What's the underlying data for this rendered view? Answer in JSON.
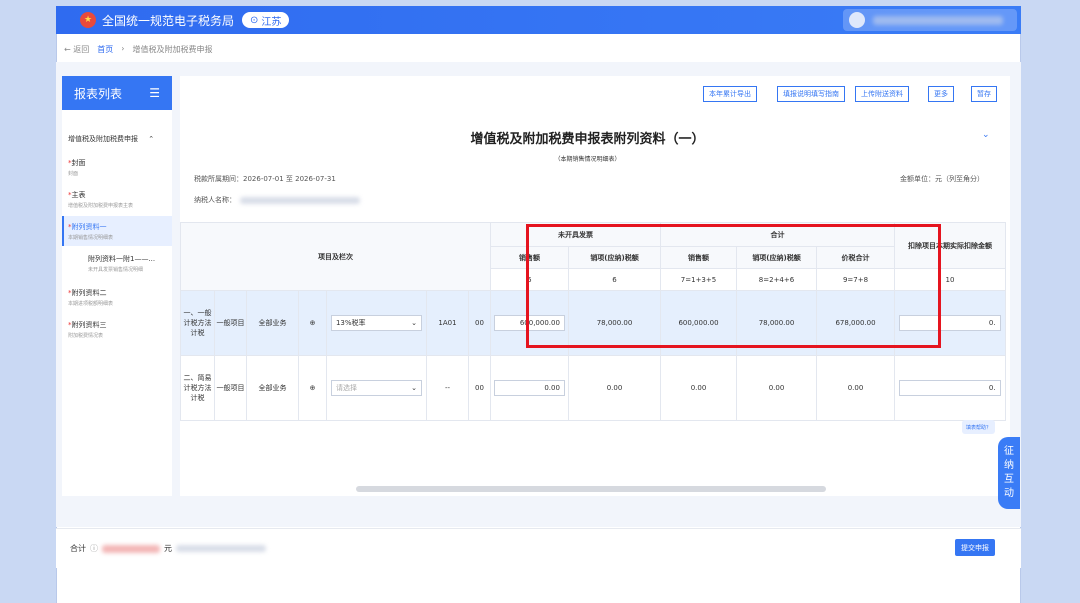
{
  "header": {
    "brand": "全国统一规范电子税务局",
    "region": "江苏",
    "region_icon": "location-pin-icon"
  },
  "breadcrumb": {
    "back": "← 返回",
    "home": "首页",
    "separator": "›",
    "current": "增值税及附加税费申报"
  },
  "sidebar": {
    "title": "报表列表",
    "group": "增值税及附加税费申报",
    "items": [
      {
        "label": "封面",
        "sub": "封面"
      },
      {
        "label": "主表",
        "sub": "增值税及附加税费申报表主表"
      },
      {
        "label": "附列资料一",
        "sub": "本期销售情况明细表"
      },
      {
        "label": "附列资料一附1——...",
        "sub": "未开具发票销售情况明细"
      },
      {
        "label": "附列资料二",
        "sub": "本期进项税额明细表"
      },
      {
        "label": "附列资料三",
        "sub": "附加税费情况表"
      }
    ]
  },
  "toolbar": {
    "btn1": "本年累计导出",
    "btn2": "填报说明填写指南",
    "btn3": "上传附送资料",
    "btn4": "更多",
    "btn5": "暂存"
  },
  "form": {
    "title": "增值税及附加税费申报表附列资料（一）",
    "subtitle": "（本期销售情况明细表）",
    "period_label": "税款所属期间：",
    "period": "2026-07-01 至 2026-07-31",
    "taxpayer_label": "纳税人名称：",
    "unit": "金额单位：元（列至角分）"
  },
  "table": {
    "col_item": "项目及栏次",
    "group_uninvoiced": "未开具发票",
    "group_total": "合计",
    "group_deduct": "扣除项目本期实际扣除金额",
    "sub_sales": "销售额",
    "sub_tax": "销项(应纳)税额",
    "sub_sales2": "销售额",
    "sub_tax2": "销项(应纳)税额",
    "sub_total": "价税合计",
    "idx5": "5",
    "idx6": "6",
    "idx7": "7=1+3+5",
    "idx8": "8=2+4+6",
    "idx9": "9=7+8",
    "idx10": "10",
    "row1": {
      "cat": "一、一般计税方法计税",
      "sub": "一般项目",
      "biz": "全部业务",
      "rate": "13%税率",
      "code": "1A01",
      "trunc": "00",
      "sales": "600,000.00",
      "tax": "78,000.00",
      "total_sales": "600,000.00",
      "total_tax": "78,000.00",
      "total": "678,000.00",
      "deduct": "0."
    },
    "row2": {
      "cat": "二、简易计税方法计税",
      "sub": "一般项目",
      "biz": "全部业务",
      "rate": "请选择",
      "code": "--",
      "trunc": "00",
      "sales": "0.00",
      "tax": "0.00",
      "total_sales": "0.00",
      "total_tax": "0.00",
      "total": "0.00",
      "deduct": "0."
    }
  },
  "help_link": "填表帮助？",
  "float_btn": "征纳互动",
  "footer": {
    "total_label": "合计",
    "currency": "元",
    "submit": "提交申报"
  },
  "colors": {
    "primary": "#3576f3",
    "highlight_border": "#e5141f"
  }
}
